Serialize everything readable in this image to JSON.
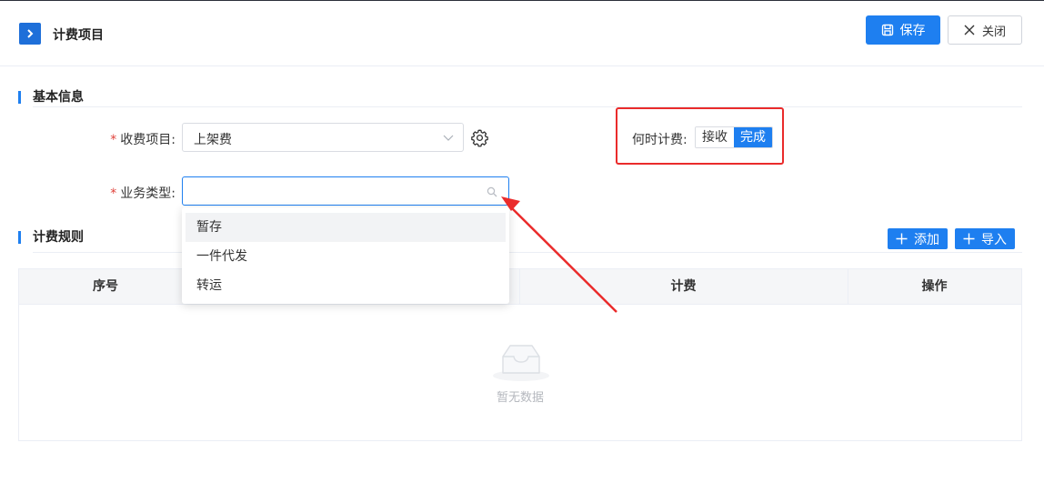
{
  "header": {
    "title": "计费项目",
    "save_label": "保存",
    "close_label": "关闭"
  },
  "sections": {
    "basic_info": "基本信息",
    "billing_rules": "计费规则"
  },
  "form": {
    "fee_item": {
      "label": "收费项目:",
      "value": "上架费"
    },
    "business_type": {
      "label": "业务类型:",
      "value": "",
      "placeholder": ""
    },
    "when_billing": {
      "label": "何时计费:",
      "options": [
        "接收",
        "完成"
      ],
      "selected": "完成"
    }
  },
  "dropdown": {
    "options": [
      "暂存",
      "一件代发",
      "转运"
    ],
    "hovered": "暂存"
  },
  "toolbar": {
    "add_label": "添加",
    "import_label": "导入"
  },
  "table": {
    "columns": [
      "序号",
      "计费",
      "操作"
    ],
    "rows": [],
    "empty_text": "暂无数据"
  },
  "colors": {
    "primary": "#1e7ff0",
    "annotation": "#ea2b2b",
    "required": "#e0423b"
  },
  "icons": [
    "chevron-right-icon",
    "save-icon",
    "close-icon",
    "chevron-down-icon",
    "gear-icon",
    "search-icon",
    "plus-icon",
    "empty-inbox-icon"
  ]
}
